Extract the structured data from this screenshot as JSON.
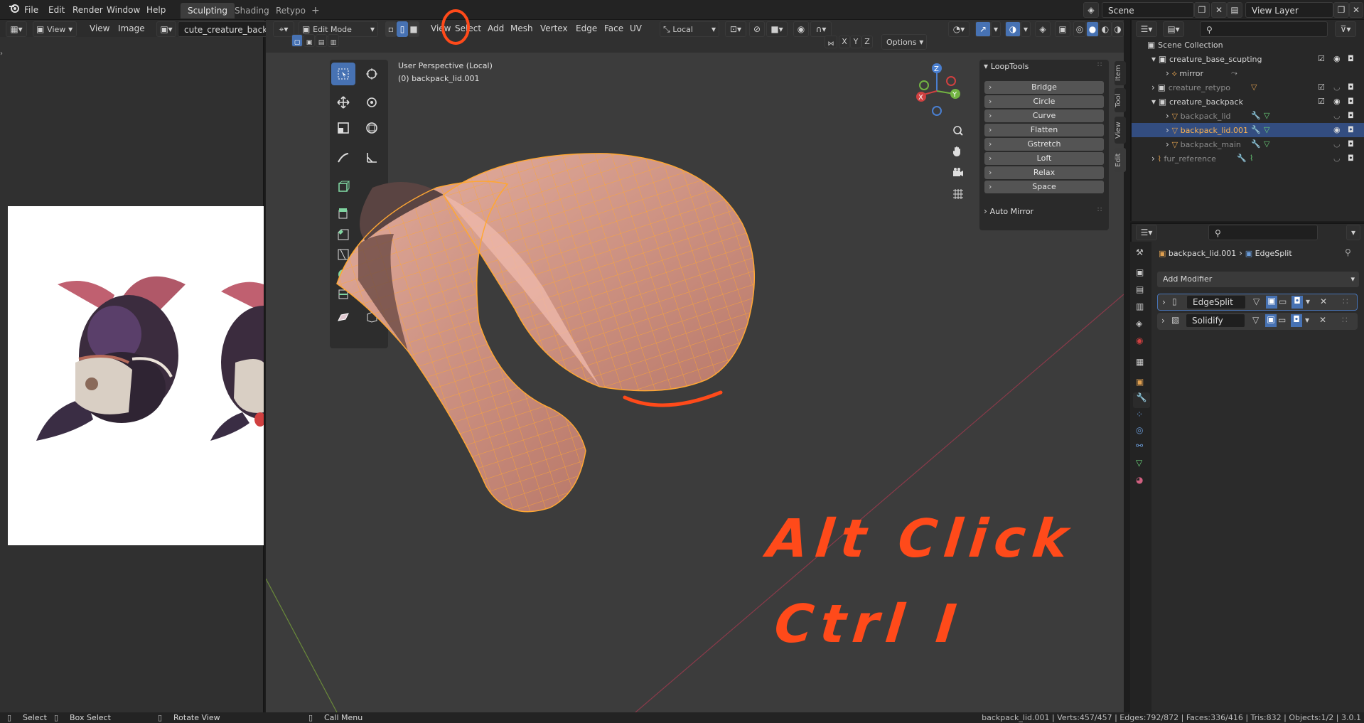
{
  "topbar": {
    "menus": [
      "File",
      "Edit",
      "Render",
      "Window",
      "Help"
    ],
    "workspaces": [
      "Sculpting",
      "Shading",
      "Retypo",
      "+"
    ],
    "active_workspace": "Sculpting",
    "scene": "Scene",
    "view_layer": "View Layer"
  },
  "image_editor": {
    "view_label": "View",
    "menus": [
      "View",
      "Image"
    ],
    "image_name": "cute_creature_backpack.jpg"
  },
  "viewport": {
    "mode": "Edit Mode",
    "menus": [
      "View",
      "Select",
      "Add",
      "Mesh",
      "Vertex",
      "Edge",
      "Face",
      "UV"
    ],
    "orientation": "Local",
    "axes": [
      "X",
      "Y",
      "Z"
    ],
    "options_label": "Options",
    "perspective_label": "User Perspective (Local)",
    "object_label": "(0) backpack_lid.001",
    "gizmo_axes": [
      "X",
      "Y",
      "Z"
    ],
    "annotation_line1": "Alt Click",
    "annotation_line2": "Ctrl I"
  },
  "npanel": {
    "loop_tools_title": "LoopTools",
    "loop_tools_buttons": [
      "Bridge",
      "Circle",
      "Curve",
      "Flatten",
      "Gstretch",
      "Loft",
      "Relax",
      "Space"
    ],
    "auto_mirror_title": "Auto Mirror",
    "tabs": [
      "Item",
      "Tool",
      "View",
      "Edit"
    ]
  },
  "outliner": {
    "rows": [
      {
        "label": "Scene Collection"
      },
      {
        "label": "creature_base_scupting"
      },
      {
        "label": "mirror"
      },
      {
        "label": "creature_retypo"
      },
      {
        "label": "creature_backpack"
      },
      {
        "label": "backpack_lid"
      },
      {
        "label": "backpack_lid.001"
      },
      {
        "label": "backpack_main"
      },
      {
        "label": "fur_reference"
      }
    ]
  },
  "properties": {
    "breadcrumb_object": "backpack_lid.001",
    "breadcrumb_modifier": "EdgeSplit",
    "add_modifier_label": "Add Modifier",
    "modifiers": [
      {
        "name": "EdgeSplit"
      },
      {
        "name": "Solidify"
      }
    ]
  },
  "statusbar": {
    "left_hints": [
      "Select",
      "Box Select",
      "Rotate View",
      "Call Menu"
    ],
    "stats": "backpack_lid.001 | Verts:457/457 | Edges:792/872 | Faces:336/416 | Tris:832 | Objects:1/2 | 3.0.1"
  },
  "colors": {
    "accent": "#4772b3",
    "annotation": "#ff4a1a",
    "mesh": "#d19b8c",
    "wire": "#ffa733",
    "selected_row": "#334d80"
  }
}
